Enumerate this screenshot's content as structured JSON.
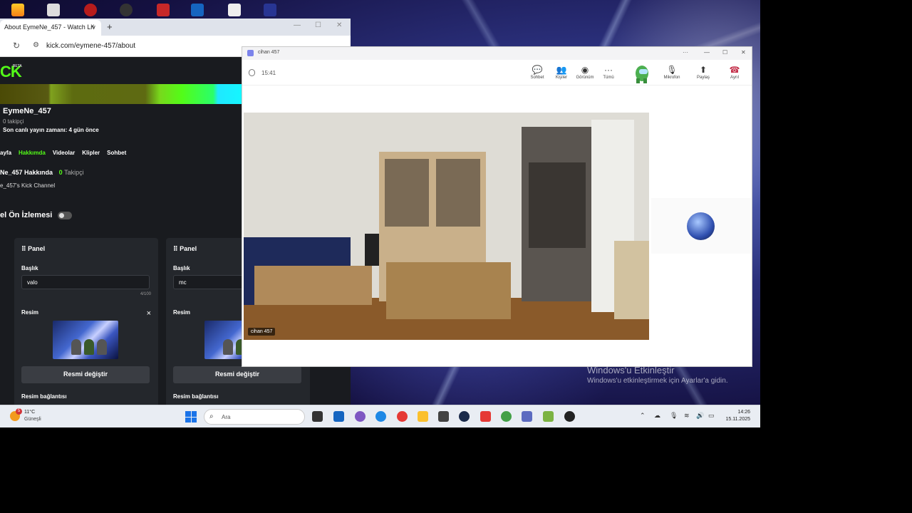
{
  "desktop": {
    "activation_title": "Windows'u Etkinleştir",
    "activation_sub": "Windows'u etkinleştirmek için Ayarlar'a gidin."
  },
  "browser": {
    "tab_title": "About EymeNe_457 - Watch Liv",
    "tab_close": "×",
    "new_tab": "+",
    "minimize": "—",
    "maximize": "☐",
    "close": "✕",
    "reload": "↻",
    "url": "kick.com/eymene-457/about"
  },
  "kick": {
    "logo": "CK",
    "beta": "BETA",
    "channel_name": "EymeNe_457",
    "followers": "0 takipçi",
    "last_stream": "Son canlı yayın zamanı: 4 gün önce",
    "tabs": [
      {
        "label": "ayfa"
      },
      {
        "label": "Hakkımda"
      },
      {
        "label": "Videolar"
      },
      {
        "label": "Klipler"
      },
      {
        "label": "Sohbet"
      }
    ],
    "about_title": "Ne_457 Hakkında",
    "about_followers_num": "0",
    "about_followers_label": "Takipçi",
    "about_desc": "e_457's Kick Channel",
    "preview_label": "el Ön İzlemesi",
    "panels": [
      {
        "header": "Panel",
        "title_label": "Başlık",
        "title_value": "valo",
        "counter": "4/100",
        "image_label": "Resim",
        "remove": "×",
        "change_button": "Resmi değiştir",
        "link_label": "Resim bağlantısı"
      },
      {
        "header": "Panel",
        "title_label": "Başlık",
        "title_value": "mc",
        "image_label": "Resim",
        "change_button": "Resmi değiştir",
        "link_label": "Resim bağlantısı"
      }
    ]
  },
  "call": {
    "window_title": "cihan 457",
    "more": "···",
    "minimize": "—",
    "maximize": "☐",
    "close": "✕",
    "timer": "15:41",
    "tools": [
      {
        "icon": "chat-icon",
        "glyph": "💬",
        "label": "Sohbet"
      },
      {
        "icon": "people-icon",
        "glyph": "👥",
        "label": "Kişiler"
      },
      {
        "icon": "view-icon",
        "glyph": "◉",
        "label": "Görünüm"
      },
      {
        "icon": "more-icon",
        "glyph": "···",
        "label": "Tümü"
      },
      {
        "icon": "mic-icon",
        "glyph": "🎙",
        "label": "Mikrofon"
      },
      {
        "icon": "share-icon",
        "glyph": "⬆",
        "label": "Paylaş"
      },
      {
        "icon": "hangup-icon",
        "glyph": "☎",
        "label": "Ayrıl"
      }
    ],
    "video_label": "cihan 457",
    "colors": {
      "hangup": "#c4314b",
      "accent": "#7b83eb"
    }
  },
  "taskbar": {
    "weather_temp": "11°C",
    "weather_desc": "Güneşli",
    "weather_badge": "5",
    "search_placeholder": "Ara",
    "time": "14:26",
    "date": "15.11.2025"
  }
}
